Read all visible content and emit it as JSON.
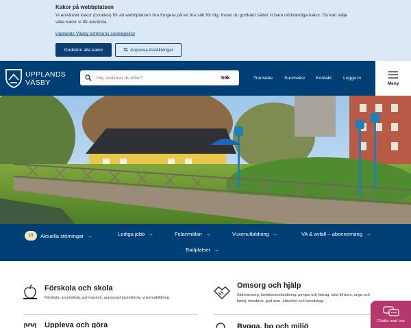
{
  "cookie": {
    "title": "Kakor på webbplatsen",
    "text": "Vi använder kakor (cookies) för att webbplatsen ska fungera på ett bra sätt för dig. Innan du godkänt sätter vi bara nödvändiga kakor. Du kan välja vilka kakor vi får använda.",
    "link": "Upplands Väsby kommuns cookiepolicy",
    "accept_label": "Godkänn alla kakor",
    "settings_label": "Anpassa inställningar"
  },
  "header": {
    "logo_line1": "UPPLANDS",
    "logo_line2": "VÄSBY",
    "search_placeholder": "Hej, vad letar du efter?",
    "search_button": "Sök",
    "nav": [
      "Translate",
      "Suomeksi",
      "Kontakt",
      "Logga in"
    ],
    "menu_label": "Meny"
  },
  "quick_links": {
    "disturbances_count": "10",
    "items": [
      "Aktuella störningar",
      "Lediga jobb",
      "Felanmälan",
      "Vuxenutbildning",
      "VA & avfall – abonnemang",
      "Badplatser"
    ]
  },
  "cards": [
    {
      "title": "Förskola och skola",
      "desc": "Förskola, grundskola, gymnasium, anpassad grundskola, vuxenutbildning.",
      "icon": "apple-icon"
    },
    {
      "title": "Omsorg och hjälp",
      "desc": "Äldreomsorg, funktionsnedsättning, pengar och bidrag, stöd till barn, unga och familj, missbruk, god man, säkerhet och beredskap.",
      "icon": "handshake-icon"
    },
    {
      "title": "Uppleva och göra",
      "icon": "castle-icon"
    },
    {
      "title": "Bygga, bo och miljö",
      "icon": "tree-icon"
    }
  ],
  "chat": {
    "label": "Chatta med oss"
  },
  "colors": {
    "brand": "#003e76",
    "cookie_bg": "#dbe9f7",
    "chat": "#b4386d"
  }
}
